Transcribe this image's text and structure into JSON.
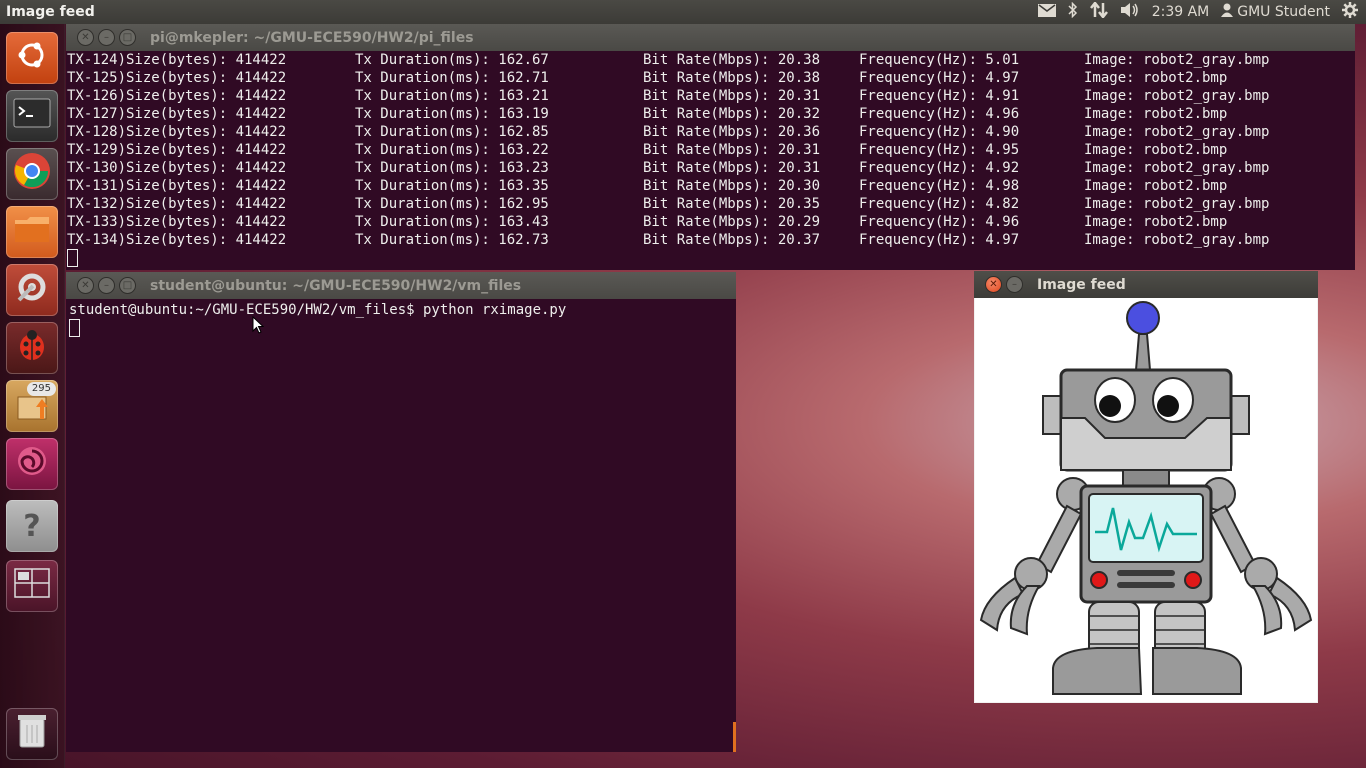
{
  "top_panel": {
    "app_title": "Image feed",
    "time": "2:39 AM",
    "user": "GMU Student",
    "icons": [
      "mail-icon",
      "bluetooth-icon",
      "network-icon",
      "volume-icon",
      "user-icon",
      "gear-icon"
    ]
  },
  "launcher": {
    "items": [
      {
        "name": "dash-home",
        "icon": "ubuntu-logo-icon"
      },
      {
        "name": "terminal",
        "icon": "terminal-icon"
      },
      {
        "name": "chrome",
        "icon": "chrome-icon"
      },
      {
        "name": "files",
        "icon": "folder-icon"
      },
      {
        "name": "system-settings",
        "icon": "settings-icon"
      },
      {
        "name": "bug-app",
        "icon": "ladybug-icon"
      },
      {
        "name": "update-manager",
        "icon": "update-icon",
        "badge": "295"
      },
      {
        "name": "app-8",
        "icon": "swirl-icon"
      },
      {
        "name": "help",
        "icon": "help-icon"
      },
      {
        "name": "workspaces",
        "icon": "workspace-icon"
      },
      {
        "name": "trash",
        "icon": "trash-icon"
      }
    ]
  },
  "terminal_top": {
    "title": "pi@mkepler: ~/GMU-ECE590/HW2/pi_files",
    "rows": [
      {
        "id": "TX-124)Size(bytes): 414422",
        "dur": "Tx Duration(ms): 162.67",
        "rate": "Bit Rate(Mbps): 20.38",
        "freq": "Frequency(Hz): 5.01",
        "img": "Image: robot2_gray.bmp"
      },
      {
        "id": "TX-125)Size(bytes): 414422",
        "dur": "Tx Duration(ms): 162.71",
        "rate": "Bit Rate(Mbps): 20.38",
        "freq": "Frequency(Hz): 4.97",
        "img": "Image: robot2.bmp"
      },
      {
        "id": "TX-126)Size(bytes): 414422",
        "dur": "Tx Duration(ms): 163.21",
        "rate": "Bit Rate(Mbps): 20.31",
        "freq": "Frequency(Hz): 4.91",
        "img": "Image: robot2_gray.bmp"
      },
      {
        "id": "TX-127)Size(bytes): 414422",
        "dur": "Tx Duration(ms): 163.19",
        "rate": "Bit Rate(Mbps): 20.32",
        "freq": "Frequency(Hz): 4.96",
        "img": "Image: robot2.bmp"
      },
      {
        "id": "TX-128)Size(bytes): 414422",
        "dur": "Tx Duration(ms): 162.85",
        "rate": "Bit Rate(Mbps): 20.36",
        "freq": "Frequency(Hz): 4.90",
        "img": "Image: robot2_gray.bmp"
      },
      {
        "id": "TX-129)Size(bytes): 414422",
        "dur": "Tx Duration(ms): 163.22",
        "rate": "Bit Rate(Mbps): 20.31",
        "freq": "Frequency(Hz): 4.95",
        "img": "Image: robot2.bmp"
      },
      {
        "id": "TX-130)Size(bytes): 414422",
        "dur": "Tx Duration(ms): 163.23",
        "rate": "Bit Rate(Mbps): 20.31",
        "freq": "Frequency(Hz): 4.92",
        "img": "Image: robot2_gray.bmp"
      },
      {
        "id": "TX-131)Size(bytes): 414422",
        "dur": "Tx Duration(ms): 163.35",
        "rate": "Bit Rate(Mbps): 20.30",
        "freq": "Frequency(Hz): 4.98",
        "img": "Image: robot2.bmp"
      },
      {
        "id": "TX-132)Size(bytes): 414422",
        "dur": "Tx Duration(ms): 162.95",
        "rate": "Bit Rate(Mbps): 20.35",
        "freq": "Frequency(Hz): 4.82",
        "img": "Image: robot2_gray.bmp"
      },
      {
        "id": "TX-133)Size(bytes): 414422",
        "dur": "Tx Duration(ms): 163.43",
        "rate": "Bit Rate(Mbps): 20.29",
        "freq": "Frequency(Hz): 4.96",
        "img": "Image: robot2.bmp"
      },
      {
        "id": "TX-134)Size(bytes): 414422",
        "dur": "Tx Duration(ms): 162.73",
        "rate": "Bit Rate(Mbps): 20.37",
        "freq": "Frequency(Hz): 4.97",
        "img": "Image: robot2_gray.bmp"
      }
    ]
  },
  "terminal_bottom": {
    "title": "student@ubuntu: ~/GMU-ECE590/HW2/vm_files",
    "prompt": "student@ubuntu:~/GMU-ECE590/HW2/vm_files$ python rximage.py"
  },
  "image_window": {
    "title": "Image feed"
  },
  "colors": {
    "terminal_bg": "#300a24",
    "terminal_fg": "#eeeeec",
    "panel_bg": "#3c3b37",
    "close_button": "#e0461d"
  }
}
